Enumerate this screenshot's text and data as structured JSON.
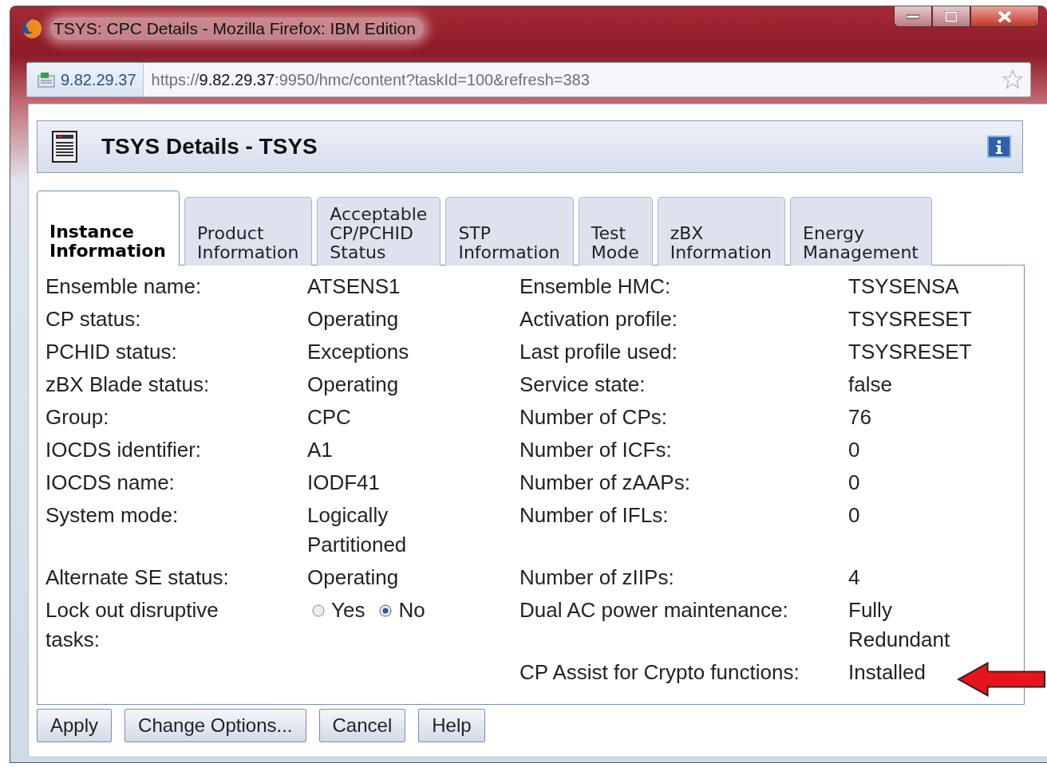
{
  "window": {
    "title": "TSYS: CPC Details - Mozilla Firefox: IBM Edition"
  },
  "address_bar": {
    "site": "9.82.29.37",
    "url": "https://**9.82.29.37**:9950/hmc/content?taskId=100&refresh=383"
  },
  "header": {
    "title": "TSYS Details - TSYS"
  },
  "tabs": [
    {
      "label": "Instance Information",
      "selected": true
    },
    {
      "label": "Product Information",
      "selected": false
    },
    {
      "label": "Acceptable CP/PCHID Status",
      "selected": false
    },
    {
      "label": "STP Information",
      "selected": false
    },
    {
      "label": "Test Mode",
      "selected": false
    },
    {
      "label": "zBX Information",
      "selected": false
    },
    {
      "label": "Energy Management",
      "selected": false
    }
  ],
  "details": [
    {
      "label": "Ensemble name:",
      "value": "ATSENS1",
      "label_2": "Ensemble HMC:",
      "value_2": "TSYSENSA"
    },
    {
      "label": "CP status:",
      "value": "Operating",
      "label_2": "Activation profile:",
      "value_2": "TSYSRESET"
    },
    {
      "label": "PCHID status:",
      "value": "Exceptions",
      "label_2": "Last profile used:",
      "value_2": "TSYSRESET"
    },
    {
      "label": "zBX Blade status:",
      "value": "Operating",
      "label_2": "Service state:",
      "value_2": "false"
    },
    {
      "label": "Group:",
      "value": "CPC",
      "label_2": "Number of CPs:",
      "value_2": "76"
    },
    {
      "label": "IOCDS identifier:",
      "value": "A1",
      "label_2": "Number of ICFs:",
      "value_2": "0"
    },
    {
      "label": "IOCDS name:",
      "value": "IODF41",
      "label_2": "Number of zAAPs:",
      "value_2": "0"
    },
    {
      "label": "System mode:",
      "value": "Logically Partitioned",
      "label_2": "Number of IFLs:",
      "value_2": "0"
    },
    {
      "label": "Alternate SE status:",
      "value": "Operating",
      "label_2": "Number of zIIPs:",
      "value_2": "4"
    },
    {
      "label": "Lock out disruptive tasks:",
      "options": [
        {
          "label": "Yes",
          "selected": false
        },
        {
          "label": "No",
          "selected": true
        }
      ],
      "label_2": "Dual AC power maintenance:",
      "value_2": "Fully Redundant"
    },
    {
      "label_2": "CP Assist for Crypto functions:",
      "value_2": "Installed"
    }
  ],
  "buttons": [
    "Apply",
    "Change Options...",
    "Cancel",
    "Help"
  ]
}
